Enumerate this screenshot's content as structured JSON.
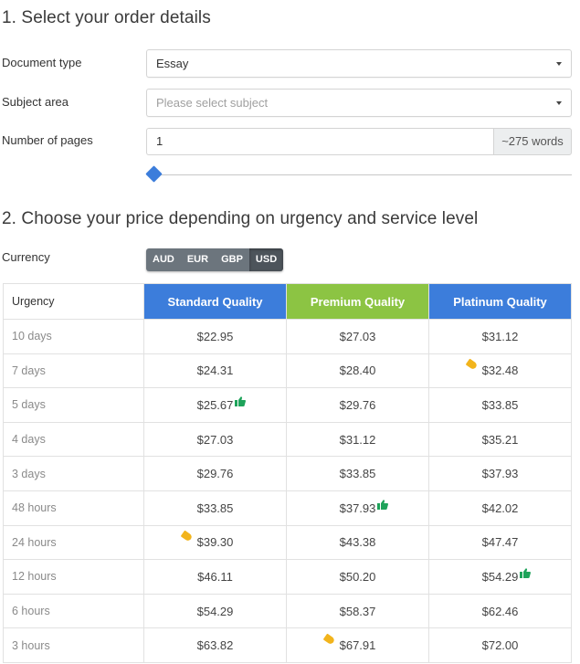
{
  "section1": {
    "title": "1. Select your order details",
    "document_type": {
      "label": "Document type",
      "value": "Essay"
    },
    "subject_area": {
      "label": "Subject area",
      "placeholder": "Please select subject"
    },
    "pages": {
      "label": "Number of pages",
      "value": "1",
      "addon": "~275 words",
      "slider_fraction": 0.0
    }
  },
  "section2": {
    "title": "2. Choose your price depending on urgency and service level",
    "currency": {
      "label": "Currency",
      "options": [
        "AUD",
        "EUR",
        "GBP",
        "USD"
      ],
      "selected": "USD"
    },
    "colors": {
      "standard": "#3c7ddb",
      "premium": "#8cc443",
      "platinum": "#3c7ddb",
      "tag": "#f2b41c",
      "thumb": "#1ea35a"
    },
    "table": {
      "headers": [
        "Urgency",
        "Standard Quality",
        "Premium Quality",
        "Platinum Quality"
      ],
      "rows": [
        {
          "urgency": "10 days",
          "standard": "$22.95",
          "premium": "$27.03",
          "platinum": "$31.12"
        },
        {
          "urgency": "7 days",
          "standard": "$24.31",
          "premium": "$28.40",
          "platinum": "$32.48",
          "platinum_icon": "tag-icon"
        },
        {
          "urgency": "5 days",
          "standard": "$25.67",
          "premium": "$29.76",
          "platinum": "$33.85",
          "standard_icon": "thumbs-up-icon"
        },
        {
          "urgency": "4 days",
          "standard": "$27.03",
          "premium": "$31.12",
          "platinum": "$35.21"
        },
        {
          "urgency": "3 days",
          "standard": "$29.76",
          "premium": "$33.85",
          "platinum": "$37.93"
        },
        {
          "urgency": "48 hours",
          "standard": "$33.85",
          "premium": "$37.93",
          "platinum": "$42.02",
          "premium_icon": "thumbs-up-icon"
        },
        {
          "urgency": "24 hours",
          "standard": "$39.30",
          "premium": "$43.38",
          "platinum": "$47.47",
          "standard_icon": "tag-icon"
        },
        {
          "urgency": "12 hours",
          "standard": "$46.11",
          "premium": "$50.20",
          "platinum": "$54.29",
          "platinum_icon": "thumbs-up-icon"
        },
        {
          "urgency": "6 hours",
          "standard": "$54.29",
          "premium": "$58.37",
          "platinum": "$62.46"
        },
        {
          "urgency": "3 hours",
          "standard": "$63.82",
          "premium": "$67.91",
          "platinum": "$72.00",
          "premium_icon": "tag-icon"
        }
      ]
    }
  }
}
